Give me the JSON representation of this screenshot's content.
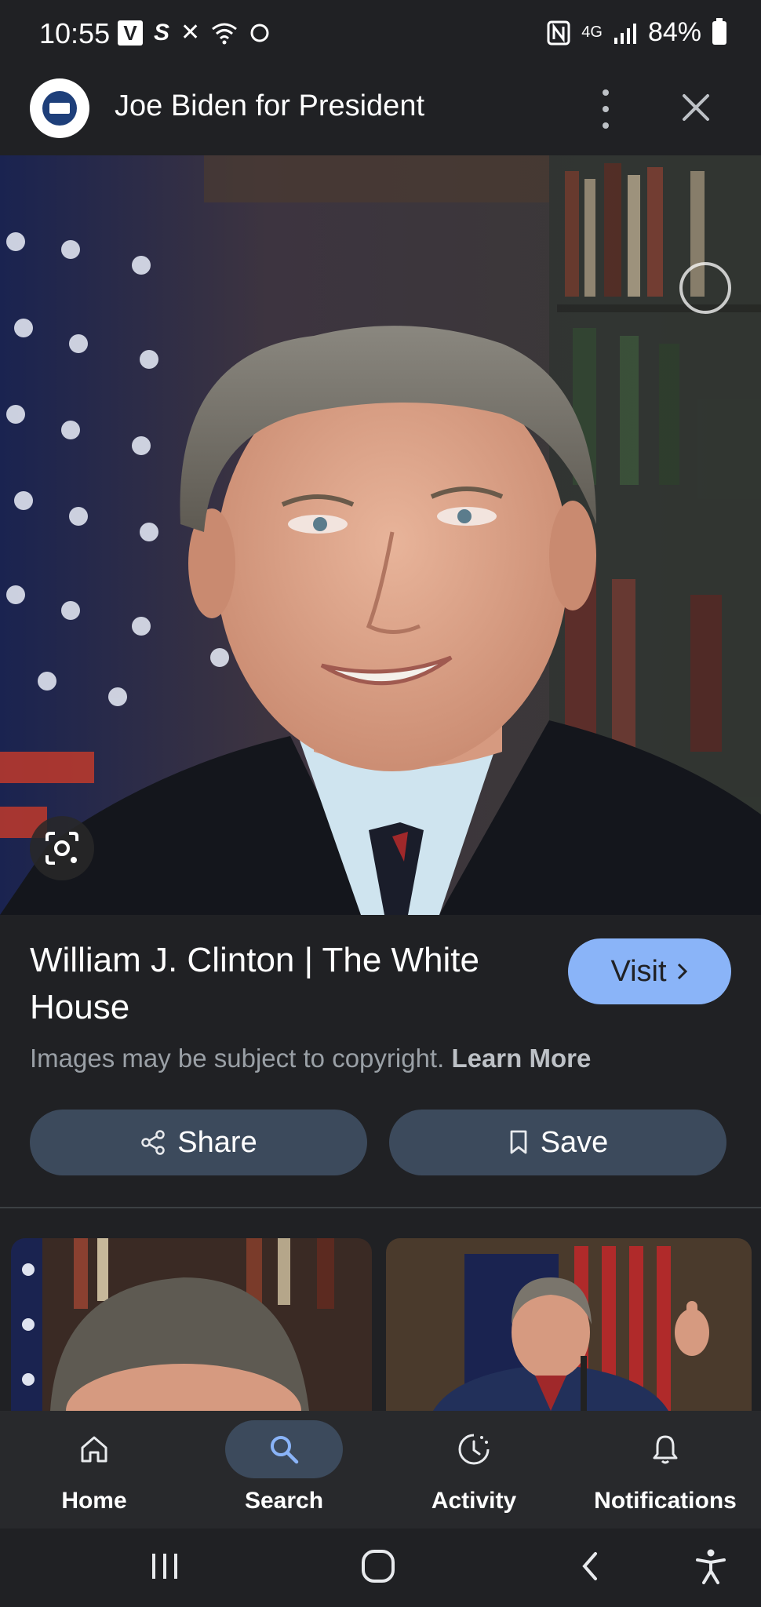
{
  "status_bar": {
    "time": "10:55",
    "left_icons": [
      "v-app-icon",
      "s-app-icon",
      "missed-call-icon",
      "wifi-icon",
      "circle-icon"
    ],
    "right_icons": [
      "nfc-icon",
      "4g-lte-icon",
      "signal-icon",
      "battery-icon"
    ],
    "network": "4G",
    "battery": "84%"
  },
  "header": {
    "title": "Joe Biden for President",
    "logo": "white-house-logo-icon"
  },
  "result": {
    "title": "William J. Clinton | The White House",
    "visit_label": "Visit",
    "copyright_text": "Images may be subject to copyright.",
    "learn_more": "Learn More",
    "share_label": "Share",
    "save_label": "Save"
  },
  "bottom_nav": {
    "items": [
      {
        "label": "Home",
        "icon": "home-icon"
      },
      {
        "label": "Search",
        "icon": "search-icon",
        "active": true
      },
      {
        "label": "Activity",
        "icon": "activity-icon"
      },
      {
        "label": "Notifications",
        "icon": "bell-icon"
      }
    ]
  },
  "colors": {
    "background": "#202124",
    "accent": "#8ab4f8",
    "button_bg": "#3c4a5c"
  }
}
